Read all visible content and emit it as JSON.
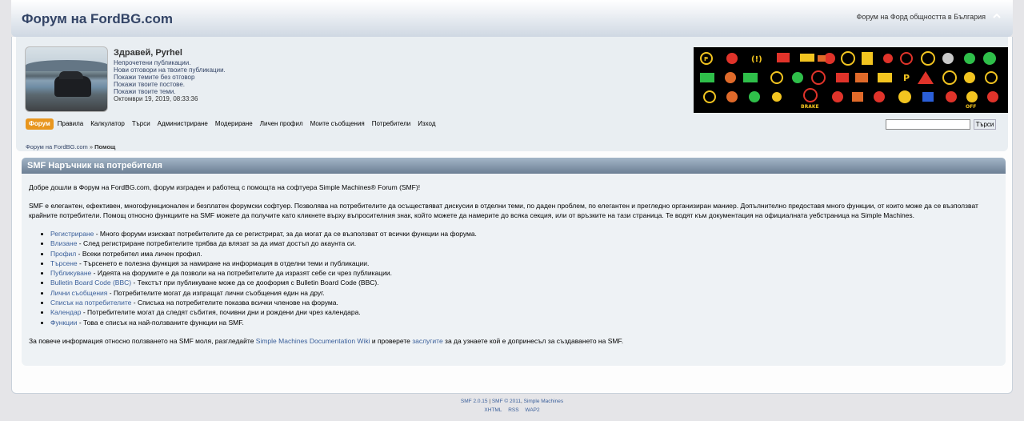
{
  "header": {
    "forum_title": "Форум на FordBG.com",
    "slogan": "Форум на Форд общността в България"
  },
  "user": {
    "greeting": "Здравей, Pyrhel",
    "links": [
      "Непрочетени публикации.",
      "Нови отговори на твоите публикации.",
      "Покажи темите без отговор",
      "Покажи твоите постове.",
      "Покажи твоите теми."
    ],
    "date": "Октомври 19, 2019, 08:33:36"
  },
  "menu": {
    "items": [
      "Форум",
      "Правила",
      "Калкулатор",
      "Търси",
      "Администриране",
      "Модериране",
      "Личен профил",
      "Моите съобщения",
      "Потребители",
      "Изход"
    ],
    "active_index": 0,
    "search_value": "",
    "search_button": "Търси"
  },
  "breadcrumb": {
    "root": "Форум на FordBG.com",
    "separator": "»",
    "current": "Помощ"
  },
  "section": {
    "title": "SMF Наръчник на потребителя"
  },
  "content": {
    "intro": "Добре дошли в Форум на FordBG.com, форум изграден и работещ с помощта на софтуера Simple Machines® Forum (SMF)!",
    "description": "SMF е елегантен, ефективен, многофункционален и безплатен форумски софтуер. Позволява на потребителите да осъществяват дискусии в отделни теми, по даден проблем, по елегантен и прегледно организиран маниер. Допълнително предоставя много функции, от които може да се възползват крайните потребители. Помощ относно функциите на SMF можете да получите като кликнете върху въпросителния знак, който можете да намерите до всяка секция, или от връзките на тази страница. Те водят към документация на официалната уебстраница на Simple Machines.",
    "features": [
      {
        "link": "Регистриране",
        "text": " - Много форуми изискват потребителите да се регистрират, за да могат да се възползват от всички функции на форума."
      },
      {
        "link": "Влизане",
        "text": " - След регистриране потребителите трябва да влязат за да имат достъп до акаунта си."
      },
      {
        "link": "Профил",
        "text": " - Всеки потребител има личен профил."
      },
      {
        "link": "Търсене",
        "text": " - Търсенето е полезна функция за намиране на информация в отделни теми и публикации."
      },
      {
        "link": "Публикуване",
        "text": " - Идеята на форумите е да позволи на на потребителите да изразят себе си чрез публикации."
      },
      {
        "link": "Bulletin Board Code (BBC)",
        "text": " - Текстът при публикуване може да се дооформя с Bulletin Board Code (BBC)."
      },
      {
        "link": "Лични съобщения",
        "text": " - Потребителите могат да изпращат лични съобщения един на друг."
      },
      {
        "link": "Списък на потребителите",
        "text": " - Списъка на потребителите показва всички членове на форума."
      },
      {
        "link": "Календар",
        "text": " - Потребителите могат да следят събития, почивни дни и рождени дни чрез календара."
      },
      {
        "link": "Функции",
        "text": " - Това е списък на най-ползваните функции на SMF."
      }
    ],
    "outro_prefix": "За повече информация относно ползването на SMF моля, разгледайте ",
    "outro_link1": "Simple Machines Documentation Wiki",
    "outro_middle": " и проверете ",
    "outro_link2": "заслугите",
    "outro_suffix": " за да узнаете кой е допринесъл за създаването на SMF."
  },
  "footer": {
    "line1_a": "SMF 2.0.15",
    "line1_sep": " | ",
    "line1_b": "SMF © 2011",
    "line1_c": ", ",
    "line1_d": "Simple Machines",
    "links": [
      "XHTML",
      "RSS",
      "WAP2"
    ]
  },
  "colors": {
    "menu_active": "#e8961e",
    "cat_bar": "#6c7f94",
    "link": "#3a5f9a"
  }
}
